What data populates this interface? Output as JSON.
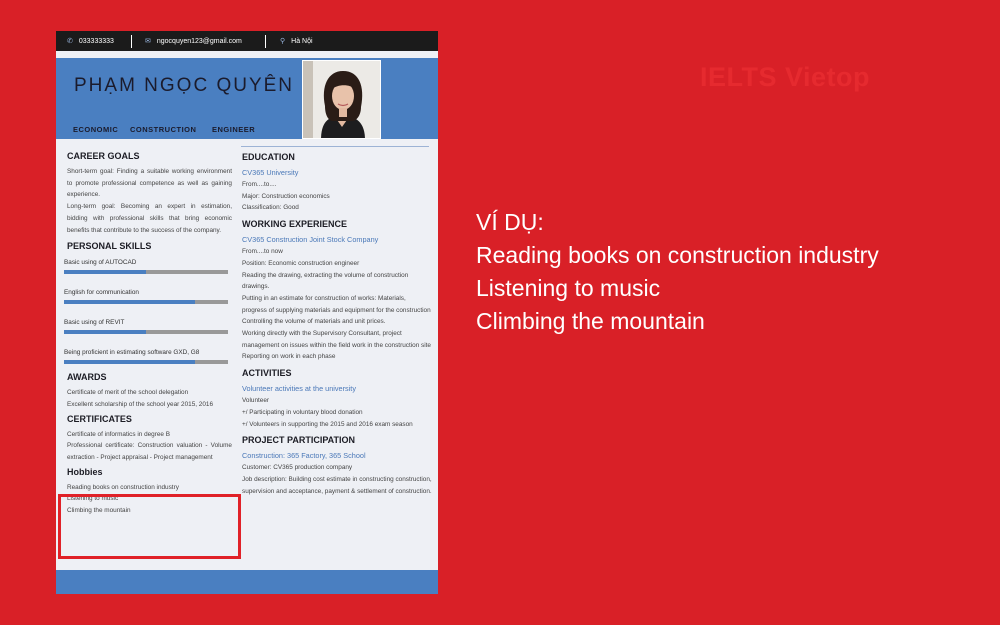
{
  "brand": {
    "text": "IELTS Vietop",
    "color": "#e62a2f"
  },
  "cv": {
    "contact": {
      "phone": "033333333",
      "email": "ngocquyen123@gmail.com",
      "location": "Hà Nội"
    },
    "name": "PHẠM NGỌC QUYÊN",
    "role": [
      "ECONOMIC",
      "CONSTRUCTION",
      "ENGINEER"
    ],
    "career_goals": {
      "title": "CAREER GOALS",
      "short_term": "Short-term goal: Finding a suitable working environment to promote professional competence as well as gaining experience.",
      "long_term": "Long-term goal: Becoming an expert in estimation, bidding with professional skills that bring economic benefits that contribute to the success of the company."
    },
    "skills": {
      "title": "PERSONAL SKILLS",
      "items": [
        {
          "label": "Basic using of AUTOCAD",
          "level": 0.5
        },
        {
          "label": "English for communication",
          "level": 0.8
        },
        {
          "label": "Basic using of REVIT",
          "level": 0.5
        },
        {
          "label": "Being proficient in estimating software GXD, G8",
          "level": 0.8
        }
      ]
    },
    "awards": {
      "title": "AWARDS",
      "lines": [
        "Certificate of merit of the school delegation",
        "Excellent scholarship of the school year 2015, 2016"
      ]
    },
    "certificates": {
      "title": "CERTIFICATES",
      "line1": "Certificate of informatics in degree B",
      "line2": "Professional certificate: Construction valuation - Volume extraction - Project appraisal - Project management"
    },
    "hobbies": {
      "title": "Hobbies",
      "items": [
        "Reading books on construction industry",
        "Listening to music",
        "Climbing the mountain"
      ]
    },
    "education": {
      "title": "EDUCATION",
      "school": "CV365 University",
      "period": "From....to....",
      "major": "Major: Construction economics",
      "classification": "Classification: Good"
    },
    "experience": {
      "title": "WORKING EXPERIENCE",
      "company": "CV365 Construction Joint Stock Company",
      "period": "From....to now",
      "lines": [
        "Position: Economic construction engineer",
        "Reading the drawing, extracting the volume of construction drawings.",
        "Putting in an estimate for construction of works: Materials, progress of supplying materials and equipment for the construction",
        "Controlling the volume of materials and unit prices.",
        "Working directly with the Supervisory Consultant, project management on issues within the field work in the construction site",
        "Reporting on work in each phase"
      ]
    },
    "activities": {
      "title": "ACTIVITIES",
      "org": "Volunteer activities at the university",
      "lines": [
        "Volunteer",
        "+/ Participating in voluntary blood donation",
        "+/ Volunteers in supporting the 2015 and 2016 exam season"
      ]
    },
    "projects": {
      "title": "PROJECT PARTICIPATION",
      "name": "Construction: 365 Factory, 365 School",
      "customer": "Customer: CV365 production company",
      "description": "Job description: Building cost estimate in constructing construction, supervision and acceptance, payment & settlement of construction."
    }
  },
  "example": {
    "title": "VÍ DỤ:",
    "items": [
      "Reading books on construction industry",
      "Listening to music",
      "Climbing the mountain"
    ]
  },
  "colors": {
    "background": "#d92027",
    "header": "#4a7fc1",
    "highlight": "#e02128"
  }
}
